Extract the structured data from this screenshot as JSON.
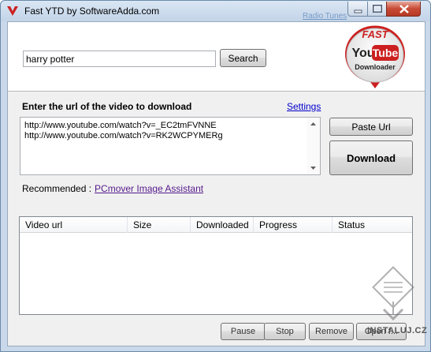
{
  "window": {
    "title": "Fast YTD by SoftwareAdda.com",
    "background_link_fragment": "Radio Tunes"
  },
  "search": {
    "value": "harry potter",
    "button_label": "Search"
  },
  "logo": {
    "line1": "FAST",
    "line2_a": "You",
    "line2_b": "Tube",
    "line3": "Downloader"
  },
  "url_section": {
    "label": "Enter the url of the video to download",
    "settings_label": "Settings",
    "urls": [
      "http://www.youtube.com/watch?v=_EC2tmFVNNE",
      "http://www.youtube.com/watch?v=RK2WCPYMERg"
    ],
    "paste_label": "Paste Url",
    "download_label": "Download"
  },
  "recommended": {
    "label": "Recommended :",
    "link": "PCmover Image Assistant"
  },
  "grid": {
    "columns": [
      "Video url",
      "Size",
      "Downloaded",
      "Progress",
      "Status"
    ],
    "rows": []
  },
  "actions": {
    "pause": "Pause",
    "stop": "Stop",
    "remove": "Remove",
    "open": "Open f..."
  },
  "watermark": "INSTALUJ.CZ",
  "colors": {
    "accent_red": "#cc2020",
    "link_blue": "#0000cc",
    "visited_link": "#551a8b"
  }
}
